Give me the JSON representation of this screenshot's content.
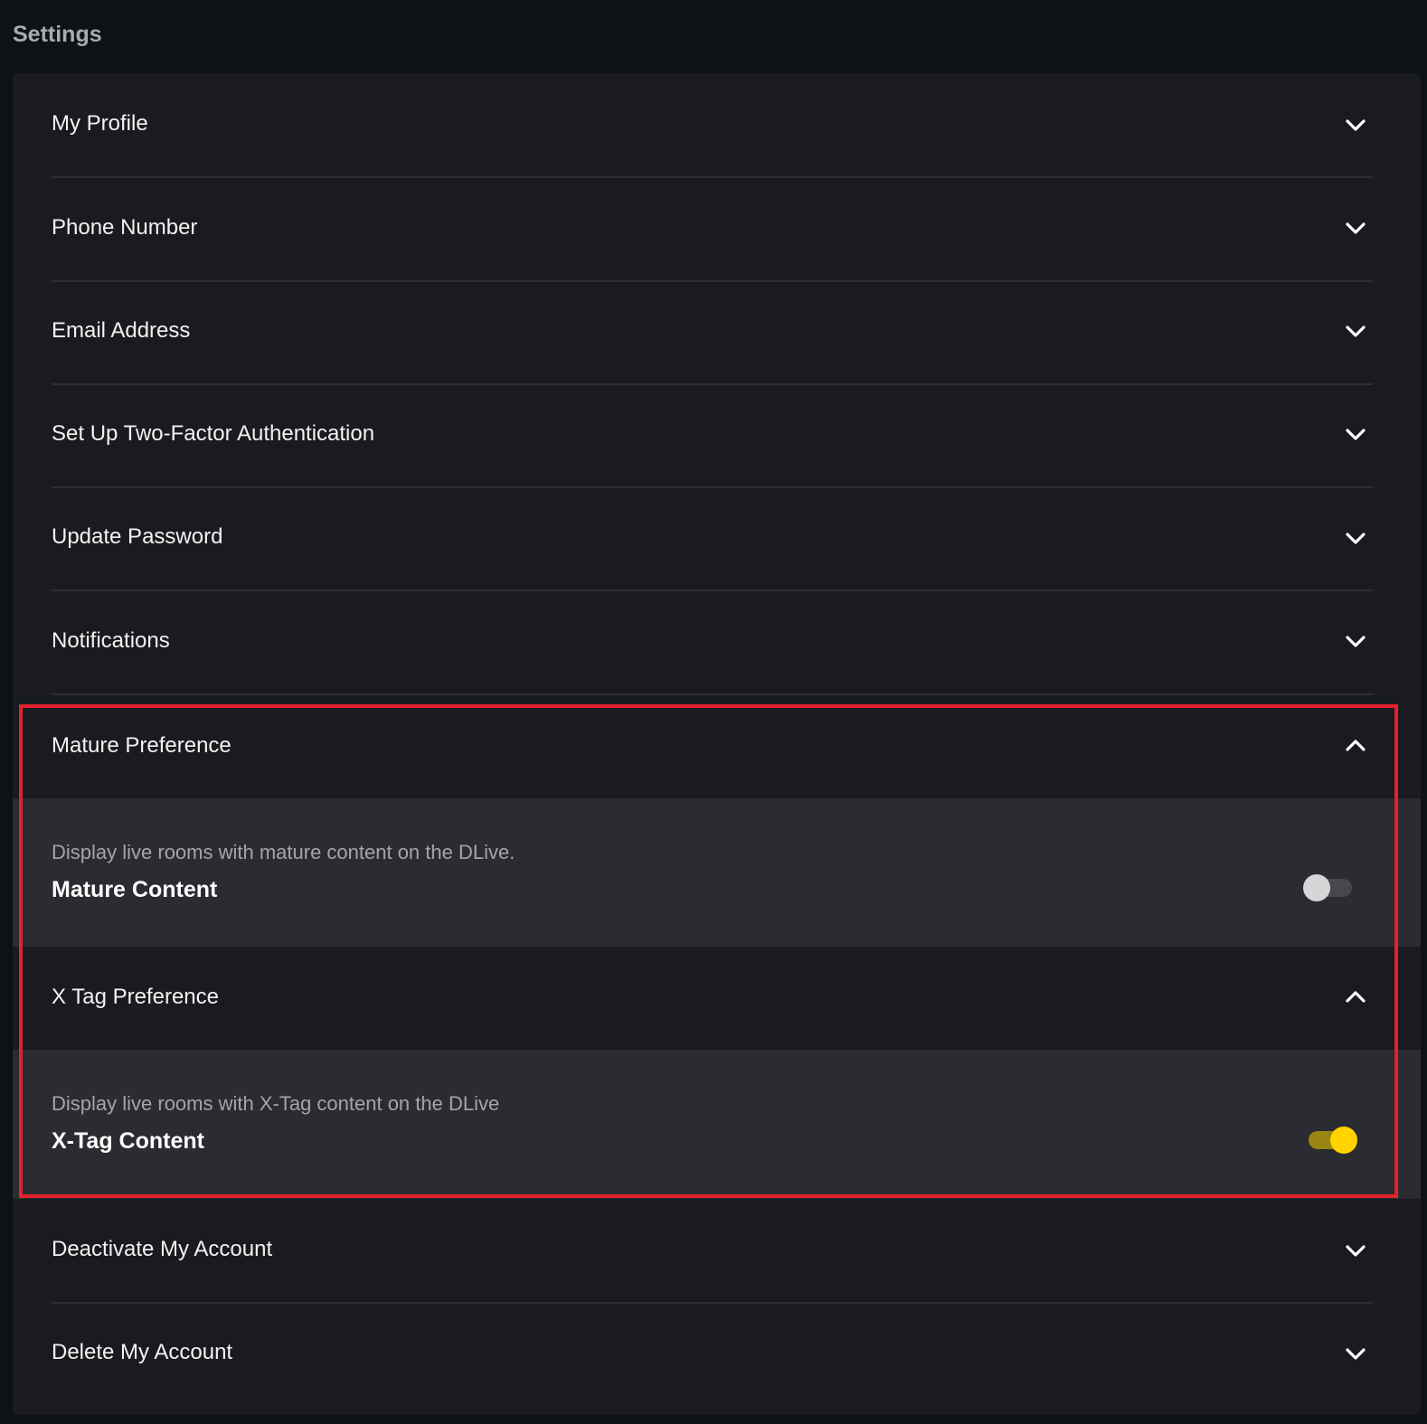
{
  "page": {
    "title": "Settings"
  },
  "settings": {
    "items": [
      {
        "label": "My Profile",
        "state": "collapsed"
      },
      {
        "label": "Phone Number",
        "state": "collapsed"
      },
      {
        "label": "Email Address",
        "state": "collapsed"
      },
      {
        "label": "Set Up Two-Factor Authentication",
        "state": "collapsed"
      },
      {
        "label": "Update Password",
        "state": "collapsed"
      },
      {
        "label": "Notifications",
        "state": "collapsed"
      },
      {
        "label": "Mature Preference",
        "state": "expanded",
        "setting": {
          "description": "Display live rooms with mature content on the DLive.",
          "name": "Mature Content",
          "enabled": false
        }
      },
      {
        "label": "X Tag Preference",
        "state": "expanded",
        "setting": {
          "description": "Display live rooms with X-Tag content on the DLive",
          "name": "X-Tag Content",
          "enabled": true
        }
      },
      {
        "label": "Deactivate My Account",
        "state": "collapsed"
      },
      {
        "label": "Delete My Account",
        "state": "collapsed"
      }
    ]
  },
  "colors": {
    "background": "#0e1116",
    "panel": "#1a1b1f",
    "subpanel": "#2a2c31",
    "toggle_on": "#ffd400",
    "highlight": "#e2222c"
  },
  "icons": {
    "collapsed": "chevron-down-icon",
    "expanded": "chevron-up-icon"
  }
}
